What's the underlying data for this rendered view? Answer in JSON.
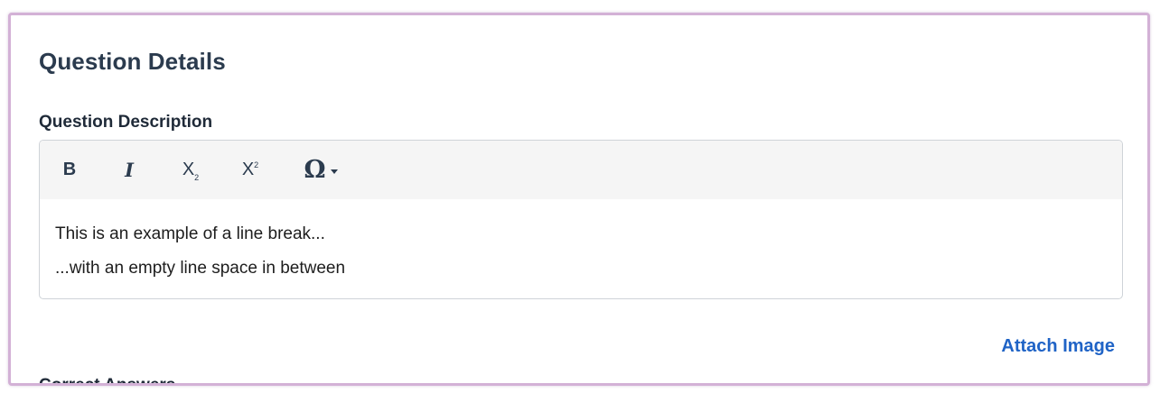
{
  "section": {
    "title": "Question Details"
  },
  "description": {
    "label": "Question Description",
    "toolbar": {
      "bold": "B",
      "italic": "I",
      "subscript_main": "X",
      "subscript_small": "2",
      "superscript_main": "X",
      "superscript_small": "2",
      "special_char": "Ω"
    },
    "lines": [
      "This is an example of a line break...",
      "...with an empty line space in between"
    ]
  },
  "attach_image": "Attach Image",
  "next_section_label": "Correct Answers",
  "colors": {
    "frame_border": "#d3b1d6",
    "title_text": "#2b3b4e",
    "link": "#1f63c6",
    "toolbar_bg": "#f5f5f5"
  },
  "icons": {
    "bold": "bold-icon",
    "italic": "italic-icon",
    "subscript": "subscript-icon",
    "superscript": "superscript-icon",
    "special_char": "omega-icon",
    "dropdown": "caret-down-icon"
  }
}
